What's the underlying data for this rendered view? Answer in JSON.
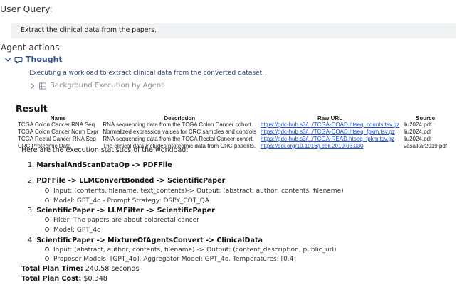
{
  "header": {
    "user_query_heading": "User Query:",
    "query_text": "Extract the clinical data from the papers."
  },
  "agent_actions": {
    "heading": "Agent actions:",
    "thought_label": "Thought",
    "thought_text": "Executing a workload to extract clinical data from the converted dataset.",
    "background_label": "Background Execution by Agent"
  },
  "result": {
    "title": "Result",
    "columns": [
      "Name",
      "Description",
      "Raw URL",
      "Source"
    ],
    "rows": [
      [
        "TCGA Colon Cancer RNA Seq",
        "RNA sequencing data from the TCGA Colon Cancer cohort.",
        "https://gdc-hub.s3/.../TCGA-COAD.htseq_counts.tsv.gz",
        "liu2024.pdf"
      ],
      [
        "TCGA Colon Cancer Norm Expr",
        "Normalized expression values for CRC samples and controls",
        "https://gdc-hub.s3/.../TCGA-COAD.htseq_fpkm.tsv.gz",
        "liu2024.pdf"
      ],
      [
        "TCGA Rectal Cancer RNA Seq",
        "RNA sequencing data from the TCGA Rectal Cancer cohort.",
        "https://gdc-hub.s3/.../TCGA-READ.htseq_fpkm.tsv.gz",
        "liu2024.pdf"
      ],
      [
        "CRC Proteomic Data",
        "The clinical data includes proteomic  data from CRC patients.",
        "https://doi.org/10.1016/j.cell.2019.03.030",
        "vasaikar2019.pdf"
      ]
    ]
  },
  "execution": {
    "intro": "Here are the execution statistics of the workload:",
    "steps": [
      {
        "num": "1.",
        "title": "MarshalAndScanDataOp -> PDFFile",
        "subs": []
      },
      {
        "num": "2.",
        "title": "PDFFile -> LLMConvertBonded -> ScientificPaper",
        "subs": [
          "Input: (contents, filename, text_contents)-> Output: (abstract, author, contents, filename)",
          "Model: GPT_4o - Prompt Strategy: DSPY_COT_QA"
        ]
      },
      {
        "num": "3.",
        "title": "ScientificPaper -> LLMFilter -> ScientificPaper",
        "subs": [
          "Filter: The papers are about colorectal cancer",
          "Model: GPT_4o"
        ]
      },
      {
        "num": "4.",
        "title": "ScientificPaper -> MixtureOfAgentsConvert -> ClinicalData",
        "subs": [
          "Input: (abstract, author, contents, filename) -> Output: (content_description, public_url)",
          "Proposer Models: [GPT_4o], Aggregator Model: GPT_4o, Temperatures: [0.4]"
        ]
      }
    ],
    "total_time_label": "Total Plan Time:",
    "total_time_value": "240.58 seconds",
    "total_cost_label": "Total Plan Cost:",
    "total_cost_value": "$0.348"
  }
}
